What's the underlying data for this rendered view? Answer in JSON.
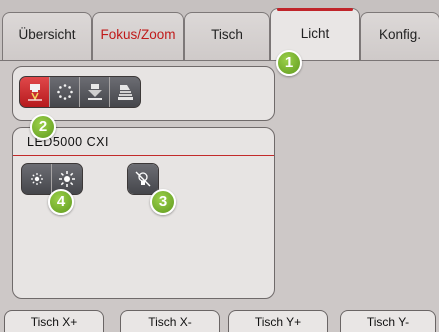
{
  "tabs": [
    {
      "label": "Übersicht"
    },
    {
      "label": "Fokus/Zoom"
    },
    {
      "label": "Tisch"
    },
    {
      "label": "Licht"
    },
    {
      "label": "Konfig."
    }
  ],
  "light_group": {
    "title": "LED5000 CXI"
  },
  "badges": [
    "1",
    "2",
    "3",
    "4"
  ],
  "bottom_buttons": [
    "Tisch X+",
    "Tisch X-",
    "Tisch Y+",
    "Tisch Y-"
  ],
  "colors": {
    "accent": "#c0242a",
    "badge": "#7bb52e"
  },
  "icons": {
    "mode_buttons": [
      "incident-light-icon",
      "ring-light-icon",
      "transmitted-light-icon",
      "oblique-light-icon"
    ],
    "brightness_buttons": [
      "brightness-down-icon",
      "brightness-up-icon"
    ],
    "light_off": "light-off-icon"
  }
}
